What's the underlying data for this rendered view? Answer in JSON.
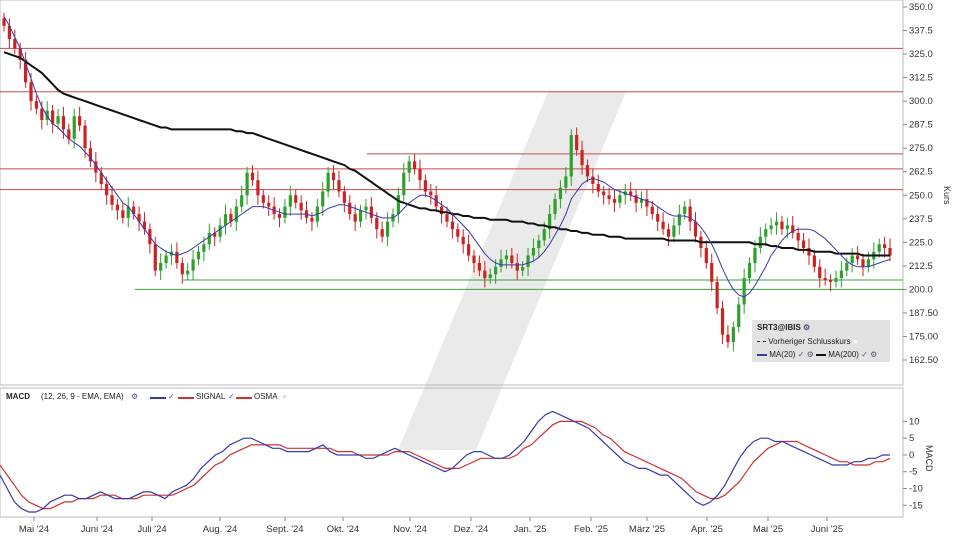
{
  "chart_data": [
    {
      "type": "candlestick",
      "symbol": "SRT3@IBIS",
      "ylabel": "Kurs",
      "ylim": [
        162.5,
        350.0
      ],
      "yticks": [
        "350.0",
        "337.5",
        "325.0",
        "312.5",
        "300.0",
        "287.5",
        "275.0",
        "262.5",
        "250.0",
        "237.5",
        "225.0",
        "212.5",
        "200.0",
        "187.50",
        "175.00",
        "162.50"
      ],
      "xticks": [
        "Mai '24",
        "Juni '24",
        "Juli '24",
        "Aug. '24",
        "Sept. '24",
        "Okt. '24",
        "Nov. '24",
        "Dez. '24",
        "Jan. '25",
        "Feb. '25",
        "März '25",
        "Apr. '25",
        "Mai '25",
        "Juni '25"
      ],
      "resistance_lines": [
        328,
        305,
        272,
        264,
        253
      ],
      "support_lines": [
        205,
        200
      ],
      "close": [
        340,
        333,
        328,
        322,
        310,
        300,
        296,
        290,
        295,
        288,
        292,
        285,
        280,
        292,
        287,
        275,
        268,
        262,
        256,
        250,
        245,
        242,
        238,
        244,
        240,
        236,
        232,
        224,
        210,
        214,
        218,
        220,
        214,
        208,
        210,
        216,
        220,
        224,
        230,
        228,
        234,
        240,
        236,
        244,
        250,
        262,
        258,
        250,
        246,
        244,
        240,
        238,
        244,
        250,
        246,
        242,
        238,
        236,
        244,
        252,
        262,
        258,
        252,
        246,
        240,
        236,
        242,
        244,
        238,
        232,
        228,
        236,
        240,
        250,
        262,
        268,
        264,
        258,
        252,
        250,
        244,
        240,
        236,
        232,
        228,
        224,
        218,
        214,
        210,
        206,
        208,
        212,
        216,
        218,
        214,
        210,
        212,
        218,
        222,
        226,
        232,
        240,
        248,
        254,
        260,
        282,
        274,
        266,
        260,
        256,
        252,
        250,
        248,
        246,
        250,
        252,
        250,
        246,
        248,
        244,
        240,
        236,
        232,
        228,
        234,
        240,
        244,
        236,
        228,
        222,
        214,
        204,
        190,
        176,
        172,
        180,
        192,
        206,
        214,
        222,
        228,
        232,
        234,
        236,
        232,
        234,
        230,
        226,
        222,
        218,
        212,
        206,
        205,
        204,
        206,
        210,
        214,
        218,
        216,
        212,
        216,
        220,
        224,
        222,
        218
      ],
      "ma20": [
        345,
        340,
        334,
        328,
        320,
        312,
        304,
        297,
        292,
        288,
        286,
        283,
        280,
        278,
        276,
        273,
        270,
        266,
        262,
        258,
        254,
        250,
        246,
        244,
        240,
        236,
        232,
        228,
        224,
        222,
        220,
        219,
        218,
        219,
        220,
        222,
        224,
        226,
        228,
        230,
        232,
        234,
        236,
        238,
        240,
        242,
        244,
        244,
        244,
        243,
        242,
        241,
        240,
        240,
        240,
        240,
        240,
        239,
        240,
        241,
        243,
        244,
        245,
        245,
        244,
        243,
        242,
        241,
        240,
        239,
        238,
        238,
        238,
        240,
        243,
        246,
        248,
        250,
        250,
        249,
        247,
        245,
        243,
        240,
        237,
        234,
        231,
        227,
        223,
        219,
        216,
        214,
        213,
        213,
        213,
        213,
        213,
        214,
        215,
        217,
        220,
        224,
        229,
        234,
        240,
        248,
        252,
        256,
        258,
        259,
        258,
        257,
        255,
        253,
        252,
        251,
        250,
        249,
        248,
        247,
        246,
        244,
        242,
        240,
        239,
        239,
        239,
        238,
        236,
        233,
        229,
        224,
        218,
        211,
        205,
        200,
        197,
        196,
        198,
        202,
        207,
        212,
        218,
        222,
        226,
        229,
        231,
        232,
        232,
        232,
        231,
        229,
        227,
        224,
        221,
        218,
        215,
        213,
        212,
        212,
        212,
        213,
        214,
        215,
        216
      ],
      "ma200": [
        326,
        325,
        324,
        323,
        321,
        319,
        317,
        315,
        312,
        309,
        306,
        304,
        303,
        302,
        301,
        300,
        299,
        298,
        297,
        296,
        295,
        294,
        293,
        292,
        291,
        290,
        289,
        288,
        287,
        286,
        286,
        285,
        285,
        285,
        285,
        285,
        285,
        285,
        285,
        285,
        285,
        285,
        285,
        284,
        284,
        283,
        283,
        282,
        281,
        280,
        279,
        278,
        277,
        276,
        275,
        274,
        273,
        272,
        271,
        270,
        269,
        268,
        267,
        266,
        264,
        263,
        261,
        259,
        257,
        255,
        253,
        251,
        249,
        247,
        246,
        245,
        244,
        243,
        243,
        242,
        242,
        241,
        241,
        240,
        240,
        239,
        239,
        238,
        238,
        238,
        237,
        237,
        237,
        237,
        236,
        236,
        236,
        235,
        235,
        234,
        234,
        233,
        233,
        232,
        232,
        231,
        231,
        230,
        230,
        229,
        229,
        229,
        228,
        228,
        228,
        227,
        227,
        227,
        227,
        227,
        227,
        227,
        227,
        226,
        226,
        226,
        226,
        226,
        226,
        225,
        225,
        225,
        225,
        225,
        225,
        225,
        225,
        225,
        225,
        224,
        224,
        224,
        223,
        223,
        222,
        222,
        222,
        221,
        221,
        221,
        220,
        220,
        220,
        220,
        219,
        219,
        219,
        219,
        219,
        218,
        218,
        218,
        218,
        218,
        218
      ],
      "legend": {
        "title": "SRT3@IBIS",
        "prev_close": "Vorheriger Schlusskurs",
        "ma20": "MA(20)",
        "ma200": "MA(200)"
      },
      "colors": {
        "up": "#2ea02e",
        "down": "#cc2222",
        "ma20": "#3a3aa8",
        "ma200": "#111111",
        "resistance": "#c84a4a",
        "support": "#3aa03a"
      }
    },
    {
      "type": "line",
      "title": "MACD",
      "params": "(12, 26, 9 - EMA, EMA)",
      "series_labels": {
        "signal": "SIGNAL",
        "osma": "OSMA"
      },
      "ylabel": "MACD",
      "ylim": [
        -17,
        14
      ],
      "yticks": [
        "10",
        "5",
        "0",
        "-5",
        "-10",
        "-15"
      ],
      "macd": [
        -6,
        -10,
        -14,
        -16,
        -17,
        -17,
        -16,
        -14,
        -13,
        -12,
        -12,
        -13,
        -13,
        -12,
        -11,
        -12,
        -13,
        -13,
        -13,
        -12,
        -11,
        -11,
        -12,
        -13,
        -11,
        -10,
        -9,
        -7,
        -4,
        -2,
        0,
        1,
        3,
        4,
        5,
        5,
        4,
        3,
        2,
        2,
        1,
        1,
        1,
        1,
        2,
        3,
        1,
        0,
        0,
        0,
        0,
        -1,
        -1,
        0,
        1,
        2,
        1,
        0,
        -1,
        -2,
        -3,
        -4,
        -5,
        -4,
        -2,
        0,
        1,
        1,
        0,
        -1,
        -1,
        0,
        2,
        4,
        7,
        10,
        12,
        13,
        12,
        11,
        10,
        9,
        8,
        6,
        4,
        2,
        0,
        -2,
        -3,
        -4,
        -4,
        -5,
        -6,
        -6,
        -8,
        -10,
        -12,
        -14,
        -15,
        -14,
        -12,
        -9,
        -5,
        -1,
        2,
        4,
        5,
        5,
        4,
        4,
        3,
        2,
        1,
        0,
        -1,
        -2,
        -3,
        -3,
        -3,
        -2,
        -2,
        -1,
        -1,
        0,
        0
      ],
      "signal": [
        -3,
        -6,
        -9,
        -12,
        -14,
        -15,
        -16,
        -16,
        -15,
        -14,
        -14,
        -13,
        -13,
        -13,
        -12,
        -12,
        -12,
        -13,
        -13,
        -13,
        -12,
        -12,
        -12,
        -12,
        -12,
        -11,
        -10,
        -9,
        -7,
        -5,
        -3,
        -2,
        0,
        1,
        2,
        3,
        3,
        3,
        3,
        3,
        2,
        2,
        2,
        2,
        2,
        2,
        2,
        1,
        1,
        1,
        0,
        0,
        0,
        0,
        0,
        1,
        1,
        1,
        0,
        -1,
        -2,
        -3,
        -4,
        -4,
        -4,
        -3,
        -2,
        -1,
        -1,
        -1,
        -1,
        -1,
        0,
        2,
        3,
        5,
        7,
        9,
        10,
        10,
        10,
        10,
        9,
        8,
        6,
        5,
        3,
        1,
        0,
        -1,
        -2,
        -3,
        -4,
        -5,
        -6,
        -7,
        -9,
        -11,
        -12,
        -13,
        -13,
        -12,
        -10,
        -8,
        -5,
        -2,
        0,
        2,
        3,
        4,
        4,
        4,
        3,
        2,
        1,
        0,
        -1,
        -2,
        -2,
        -3,
        -3,
        -3,
        -2,
        -2,
        -1
      ],
      "colors": {
        "macd": "#3a3aa8",
        "signal": "#cc3333"
      }
    }
  ]
}
